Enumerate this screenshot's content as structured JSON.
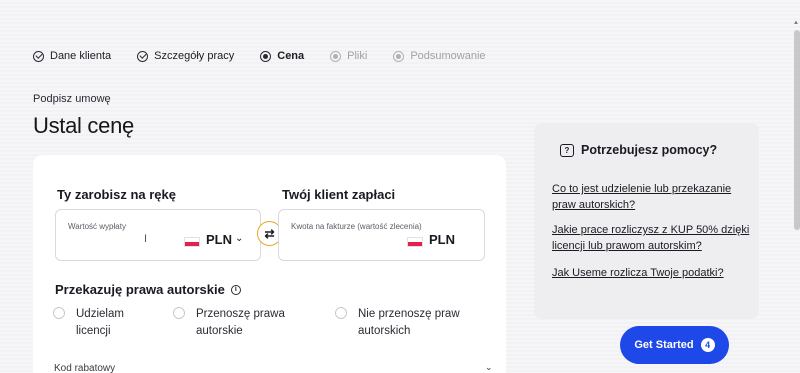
{
  "steps": [
    {
      "label": "Dane klienta",
      "state": "done"
    },
    {
      "label": "Szczegóły pracy",
      "state": "done"
    },
    {
      "label": "Cena",
      "state": "active"
    },
    {
      "label": "Pliki",
      "state": "pending"
    },
    {
      "label": "Podsumowanie",
      "state": "pending"
    }
  ],
  "page": {
    "subtitle": "Podpisz umowę",
    "title": "Ustal cenę"
  },
  "price": {
    "earn_heading": "Ty zarobisz na rękę",
    "earn_label": "Wartość wypłaty",
    "earn_currency": "PLN",
    "client_heading": "Twój klient zapłaci",
    "client_label": "Kwota na fakturze (wartość zlecenia)",
    "client_currency": "PLN"
  },
  "rights": {
    "heading": "Przekazuję prawa autorskie",
    "info": "i",
    "options": [
      {
        "line1": "Udzielam",
        "line2": "licencji"
      },
      {
        "line1": "Przenoszę prawa",
        "line2": "autorskie"
      },
      {
        "line1": "Nie przenoszę praw",
        "line2": "autorskich"
      }
    ]
  },
  "discount": {
    "label": "Kod rabatowy"
  },
  "help": {
    "heading": "Potrzebujesz pomocy?",
    "bubble": "?",
    "links": [
      "Co to jest udzielenie lub przekazanie praw autorskich?",
      "Jakie prace rozliczysz z KUP 50% dzięki licencji lub prawom autorskim?",
      "Jak Useme rozlicza Twoje podatki?"
    ]
  },
  "cta": {
    "label": "Get Started",
    "badge": "4"
  },
  "colors": {
    "accent": "#1f48e8",
    "swap_ring": "#e8a623",
    "flag_red": "#e3224a"
  }
}
